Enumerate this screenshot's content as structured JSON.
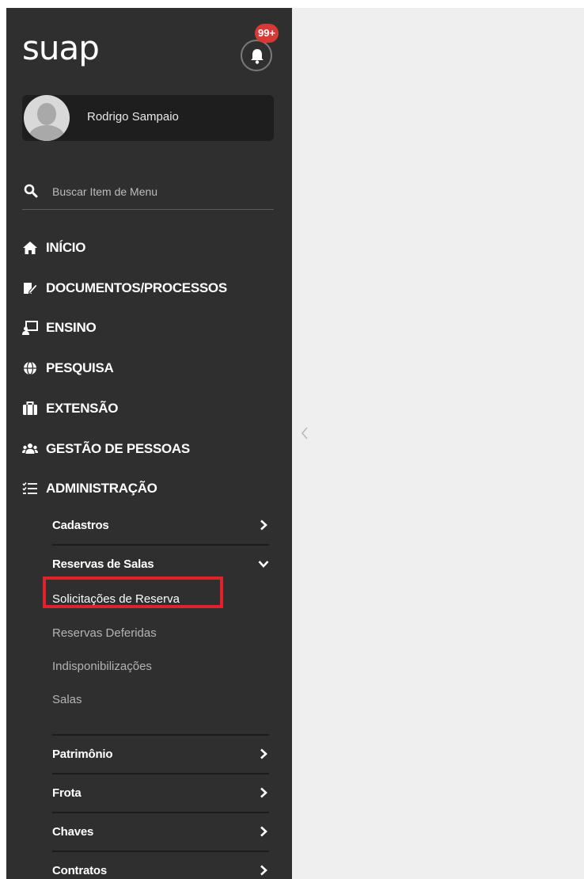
{
  "header": {
    "logo": "suap",
    "notifications_badge": "99+"
  },
  "user": {
    "name": "Rodrigo Sampaio"
  },
  "search": {
    "placeholder": "Buscar Item de Menu"
  },
  "menu": [
    {
      "label": "INÍCIO",
      "icon": "home-icon"
    },
    {
      "label": "DOCUMENTOS/PROCESSOS",
      "icon": "document-edit-icon"
    },
    {
      "label": "ENSINO",
      "icon": "teaching-icon"
    },
    {
      "label": "PESQUISA",
      "icon": "globe-icon"
    },
    {
      "label": "EXTENSÃO",
      "icon": "briefcase-icon"
    },
    {
      "label": "GESTÃO DE PESSOAS",
      "icon": "users-icon"
    },
    {
      "label": "ADMINISTRAÇÃO",
      "icon": "list-check-icon"
    }
  ],
  "admin_submenu": {
    "cadastros": "Cadastros",
    "reservas": {
      "label": "Reservas de Salas",
      "items": [
        "Solicitações de Reserva",
        "Reservas Deferidas",
        "Indisponibilizações",
        "Salas"
      ]
    },
    "patrimonio": "Patrimônio",
    "frota": "Frota",
    "chaves": "Chaves",
    "contratos": "Contratos"
  },
  "colors": {
    "sidebar_bg": "#2f2f2f",
    "content_bg": "#efefef",
    "badge": "#d63a35",
    "highlight": "#e0222d"
  }
}
